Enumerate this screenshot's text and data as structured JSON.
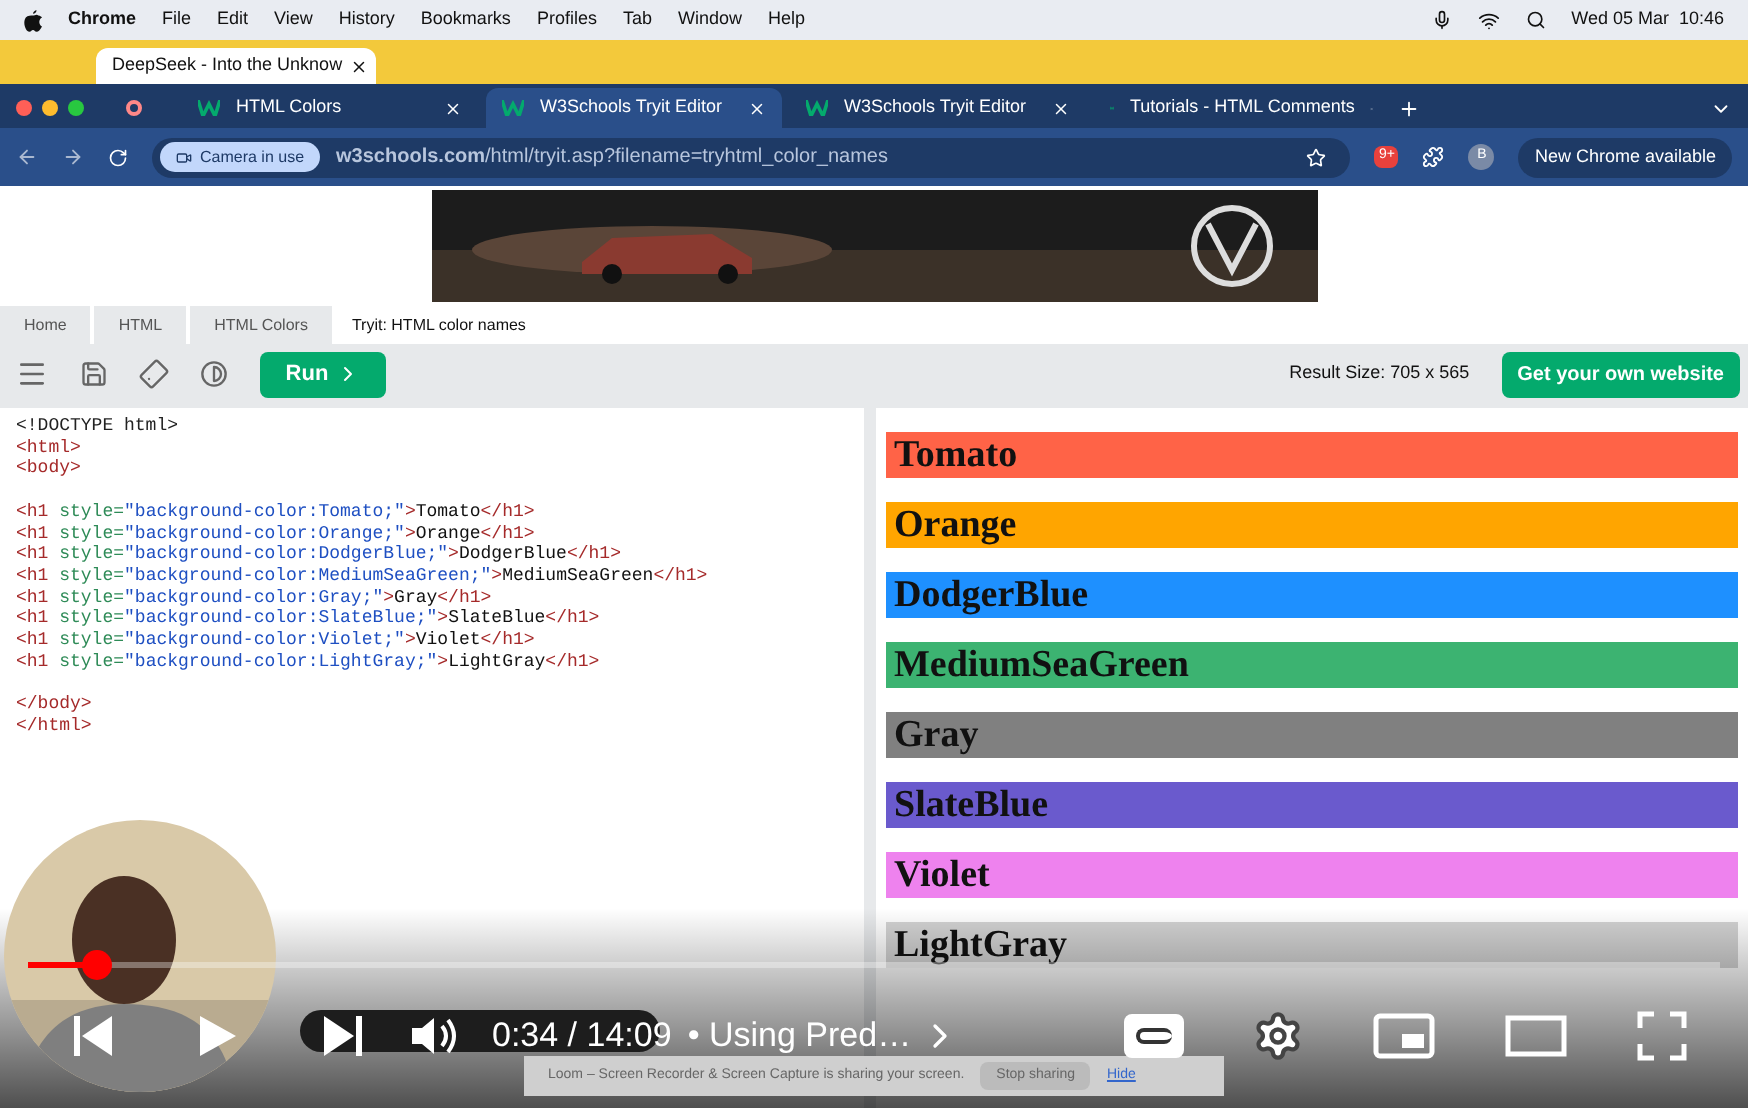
{
  "menu_bar": {
    "app": "Chrome",
    "items": [
      "File",
      "Edit",
      "View",
      "History",
      "Bookmarks",
      "Profiles",
      "Tab",
      "Window",
      "Help"
    ],
    "clock": "Wed 05 Mar  10:46"
  },
  "back_window": {
    "tab": "DeepSeek - Into the Unknow"
  },
  "tabs": [
    {
      "label": "HTML Colors",
      "selected": false
    },
    {
      "label": "W3Schools Tryit Editor",
      "selected": true
    },
    {
      "label": "W3Schools Tryit Editor",
      "selected": false
    },
    {
      "label": "Tutorials - HTML Comments",
      "selected": false
    }
  ],
  "address_bar": {
    "chip": "Camera in use",
    "url": "**w3schools.com**/html/tryit.asp?filename=tryhtml_color_names",
    "badge": "9+",
    "avatar": "B",
    "update": "New Chrome available"
  },
  "ad": {
    "kind": "picture"
  },
  "breadcrumbs": [
    "Home",
    "HTML",
    "HTML Colors",
    "Tryit: HTML color names"
  ],
  "toolbar": {
    "run": "Run",
    "result_size": "Result Size: 705 x 565",
    "cta": "Get your own website"
  },
  "code": [
    [
      "<!DOCTYPE html>",
      "<html>",
      "<body>"
    ],
    [
      "<h1 style=\"background-color:Tomato;\">Tomato</h1>",
      "<h1 style=\"background-color:Orange;\">Orange</h1>",
      "<h1 style=\"background-color:DodgerBlue;\">DodgerBlue</h1>",
      "<h1 style=\"background-color:MediumSeaGreen;\">MediumSeaGreen</h1>",
      "<h1 style=\"background-color:Gray;\">Gray</h1>",
      "<h1 style=\"background-color:SlateBlue;\">SlateBlue</h1>",
      "<h1 style=\"background-color:Violet;\">Violet</h1>",
      "<h1 style=\"background-color:LightGray;\">LightGray</h1>"
    ],
    [
      "</body>",
      "</html>"
    ]
  ],
  "result": [
    {
      "label": "Tomato",
      "color": "#ff6347"
    },
    {
      "label": "Orange",
      "color": "#ffa500"
    },
    {
      "label": "DodgerBlue",
      "color": "#1e90ff"
    },
    {
      "label": "MediumSeaGreen",
      "color": "#3cb371"
    },
    {
      "label": "Gray",
      "color": "#808080"
    },
    {
      "label": "SlateBlue",
      "color": "#6a5acd"
    },
    {
      "label": "Violet",
      "color": "#ee82ee"
    },
    {
      "label": "LightGray",
      "color": "#d3d3d3"
    }
  ],
  "loom": {
    "message": "Loom – Screen Recorder & Screen Capture is sharing your screen.",
    "stop": "Stop sharing",
    "hide": "Hide"
  },
  "player": {
    "level": 0.04,
    "time": "0:34 / 14:09",
    "chapter": "• Using Pred…"
  }
}
